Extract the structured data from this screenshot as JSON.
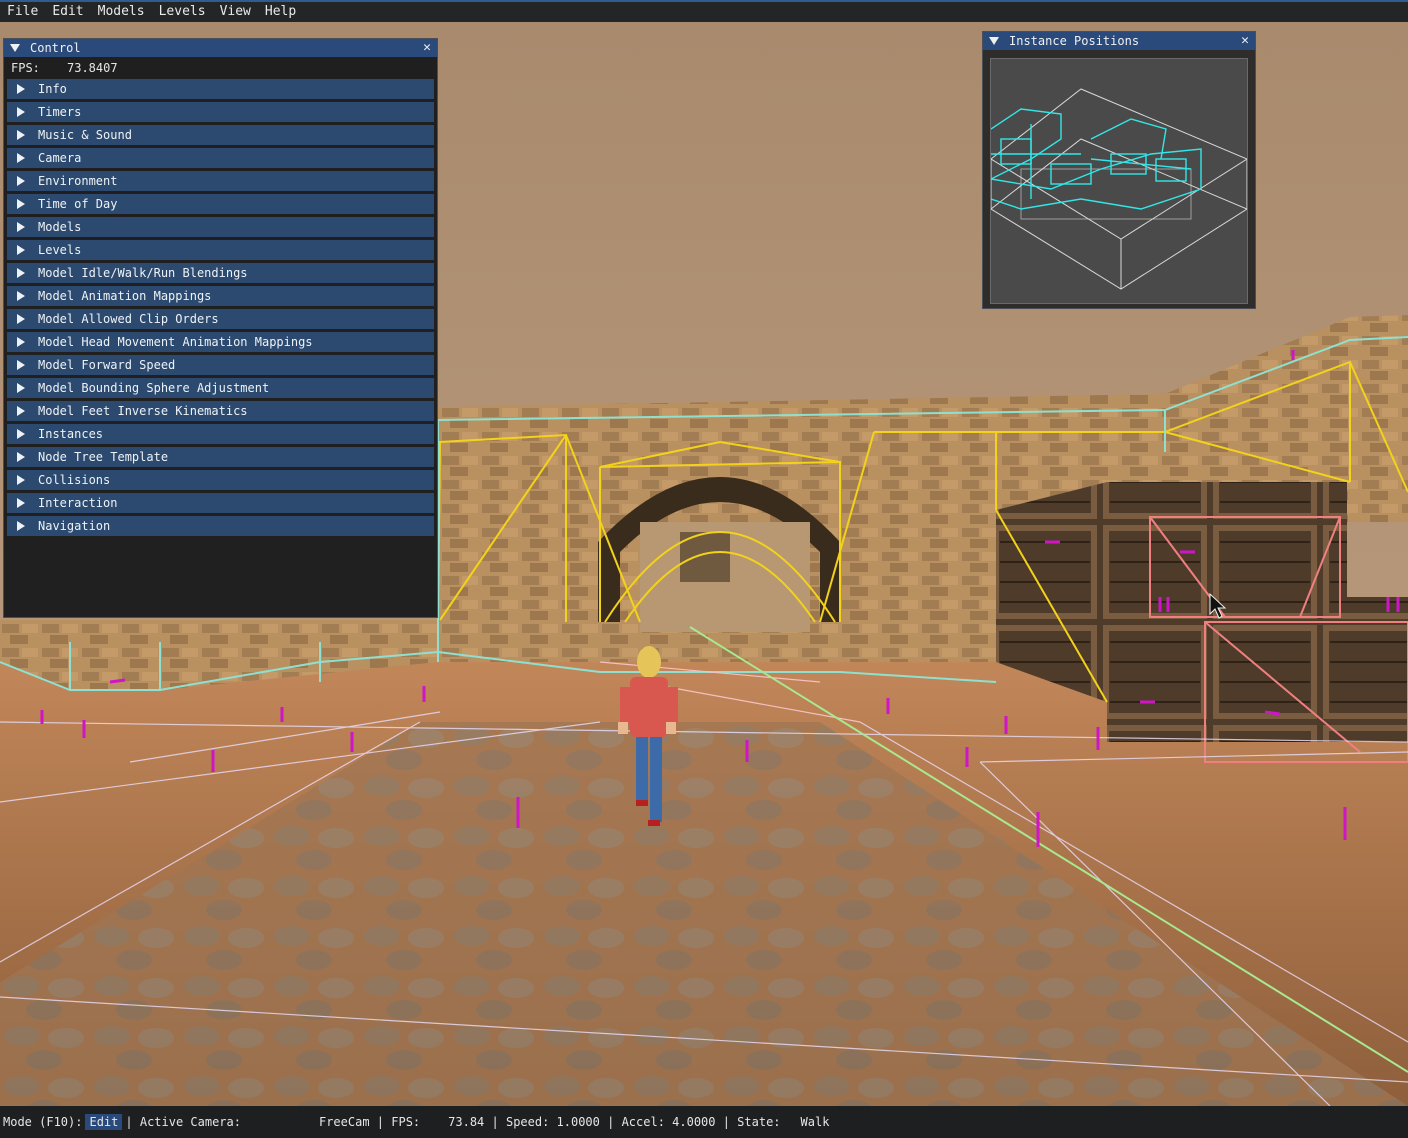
{
  "menubar": {
    "items": [
      "File",
      "Edit",
      "Models",
      "Levels",
      "View",
      "Help"
    ]
  },
  "control_window": {
    "title": "Control",
    "fps_label": "FPS:",
    "fps_value": "73.8407",
    "sections": [
      "Info",
      "Timers",
      "Music & Sound",
      "Camera",
      "Environment",
      "Time of Day",
      "Models",
      "Levels",
      "Model Idle/Walk/Run Blendings",
      "Model Animation Mappings",
      "Model Allowed Clip Orders",
      "Model Head Movement Animation Mappings",
      "Model Forward Speed",
      "Model Bounding Sphere Adjustment",
      "Model Feet Inverse Kinematics",
      "Instances",
      "Node Tree Template",
      "Collisions",
      "Interaction",
      "Navigation"
    ]
  },
  "instance_window": {
    "title": "Instance Positions"
  },
  "statusbar": {
    "mode_label": "Mode (F10):",
    "mode_value": "Edit",
    "camera_label": "| Active Camera:",
    "camera_value": "FreeCam",
    "fps_label": "| FPS:",
    "fps_value": "73.84",
    "speed": "| Speed: 1.0000",
    "accel": "| Accel: 4.0000",
    "state_label": "| State:",
    "state_value": "Walk"
  },
  "colors": {
    "menubar_bg": "#232527",
    "title_bar": "#294a7a",
    "section_bg": "#2c4a6f",
    "wire_yellow": "#f2d21a",
    "wire_cyan": "#8fe0d0",
    "wire_pink": "#f08080",
    "wire_magenta": "#d014c8",
    "minimap_cyan": "#33e6e6"
  }
}
